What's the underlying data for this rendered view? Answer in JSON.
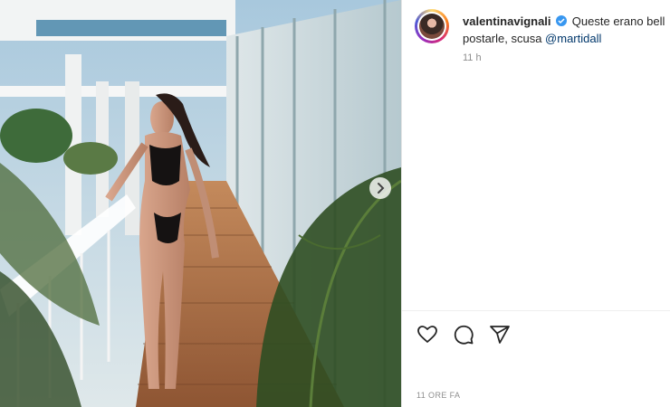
{
  "post": {
    "photo_alt": "",
    "next_icon": "chevron-right-icon"
  },
  "comment": {
    "username": "valentinavignali",
    "text_line1": "Queste erano bell",
    "text_line2": "postarle, scusa ",
    "mention": "@martidall",
    "relative_time": "11 h"
  },
  "actions": {
    "icons": [
      "heart-icon",
      "comment-icon",
      "share-icon"
    ]
  },
  "footer": {
    "date": "11 ORE FA"
  },
  "colors": {
    "verified": "#3897f0",
    "mention": "#00376b",
    "muted": "#8e8e8e"
  }
}
